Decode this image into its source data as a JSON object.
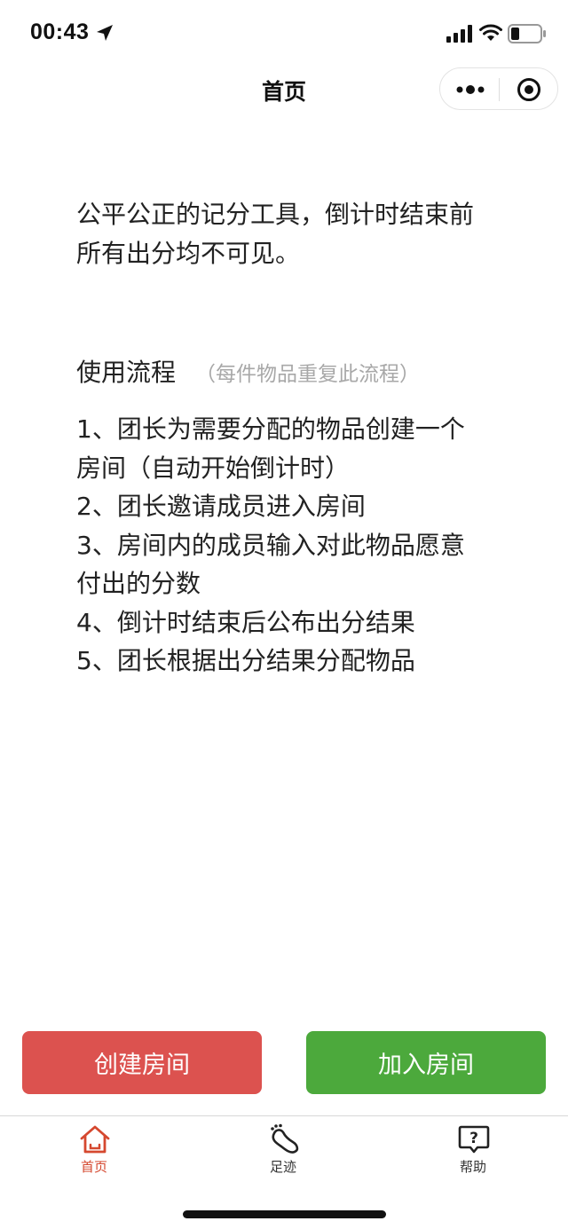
{
  "status_bar": {
    "time": "00:43"
  },
  "nav": {
    "title": "首页"
  },
  "intro": {
    "line1": "公平公正的记分工具，倒计时结束前",
    "line2": "所有出分均不可见。"
  },
  "usage": {
    "title": "使用流程",
    "note": "（每件物品重复此流程）",
    "steps": [
      "1、团长为需要分配的物品创建一个",
      "房间（自动开始倒计时）",
      "2、团长邀请成员进入房间",
      "3、房间内的成员输入对此物品愿意",
      "付出的分数",
      "4、倒计时结束后公布出分结果",
      "5、团长根据出分结果分配物品"
    ]
  },
  "actions": {
    "create_label": "创建房间",
    "join_label": "加入房间"
  },
  "tabs": [
    {
      "label": "首页",
      "icon": "home-icon",
      "active": true
    },
    {
      "label": "足迹",
      "icon": "footprint-icon",
      "active": false
    },
    {
      "label": "帮助",
      "icon": "help-icon",
      "active": false
    }
  ],
  "colors": {
    "create": "#dc524f",
    "join": "#4ca93c",
    "active_tab": "#d5482f",
    "note": "#a8a8a8"
  }
}
